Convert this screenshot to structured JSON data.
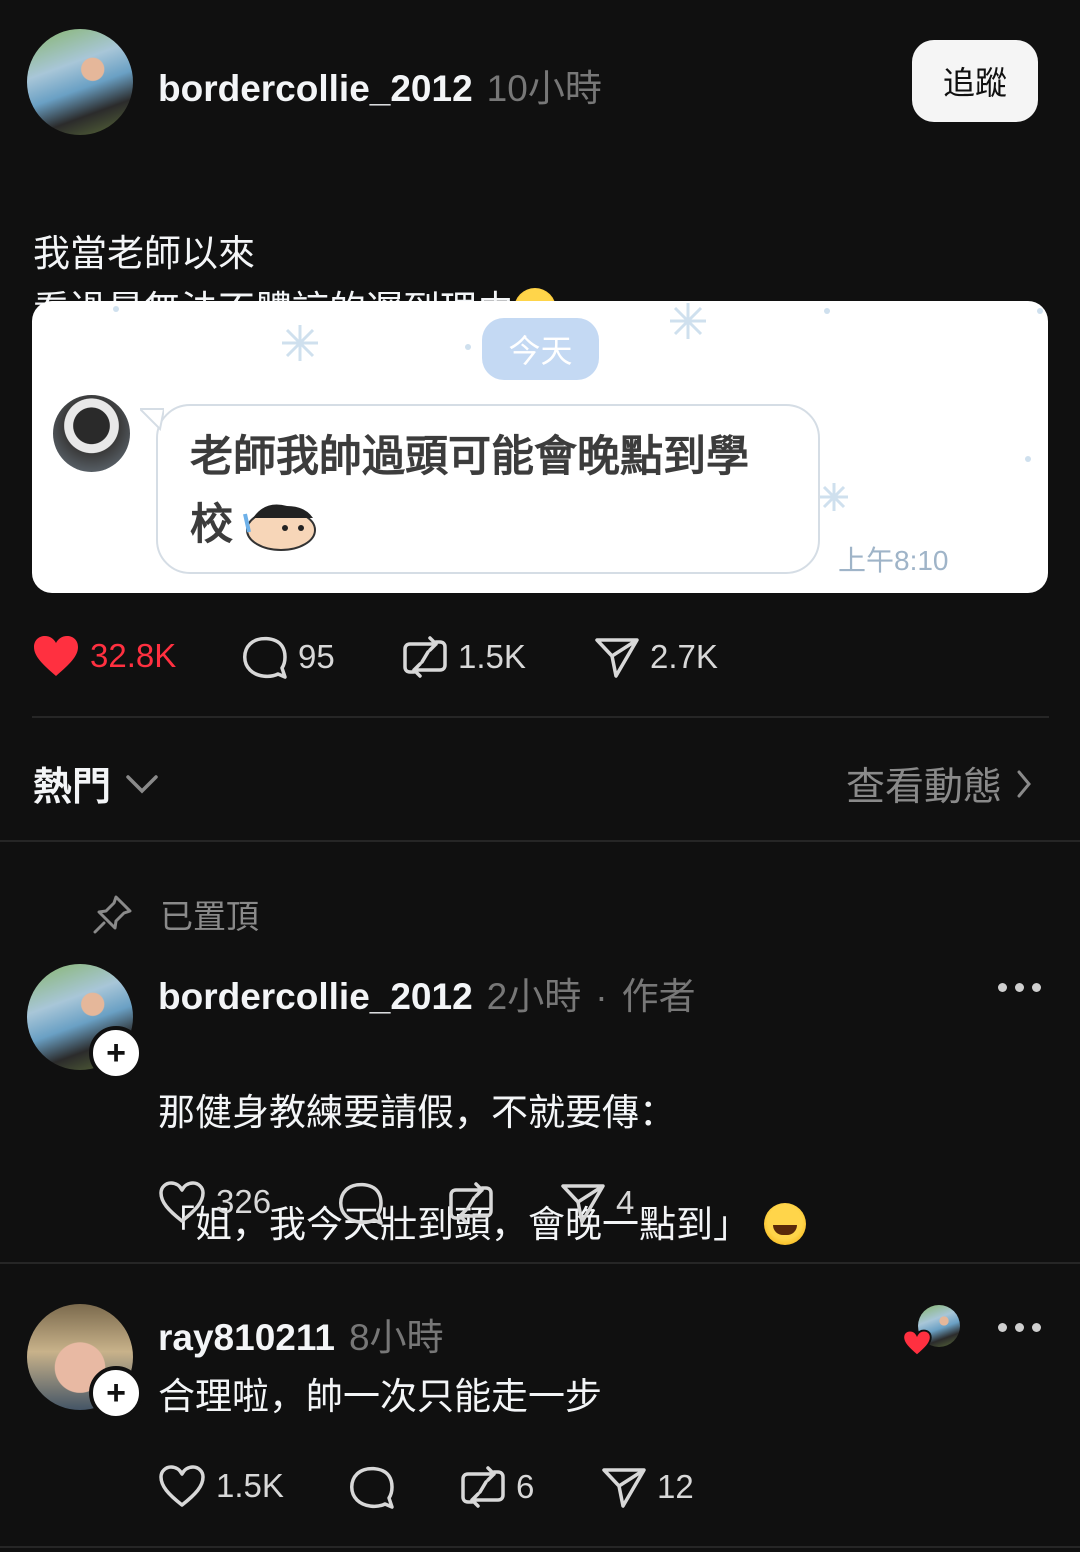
{
  "post": {
    "username": "bordercollie_2012",
    "time": "10小時",
    "follow_label": "追蹤",
    "text": "我當老師以來\n看過最無法不體諒的遲到理由",
    "emoji_icon": "rolling-on-floor-laughing-emoji",
    "image": {
      "date_pill": "今天",
      "bubble_text_line1": "老師我帥過頭可能會晚點到學",
      "bubble_text_line2": "校",
      "time": "上午8:10"
    },
    "stats": {
      "likes": "32.8K",
      "comments": "95",
      "reposts": "1.5K",
      "shares": "2.7K"
    },
    "like_color": "#ff3040"
  },
  "sort": {
    "label": "熱門",
    "activity_label": "查看動態"
  },
  "pinned_label": "已置頂",
  "replies": [
    {
      "username": "bordercollie_2012",
      "time": "2小時",
      "author_tag": "作者",
      "text_line1": "那健身教練要請假，不就要傳：",
      "text_line2": "「姐，我今天壯到頭，會晚一點到」",
      "likes": "326",
      "shares": "4"
    },
    {
      "username": "ray810211",
      "time": "8小時",
      "text": "合理啦，帥一次只能走一步",
      "likes": "1.5K",
      "reposts": "6",
      "shares": "12"
    }
  ]
}
